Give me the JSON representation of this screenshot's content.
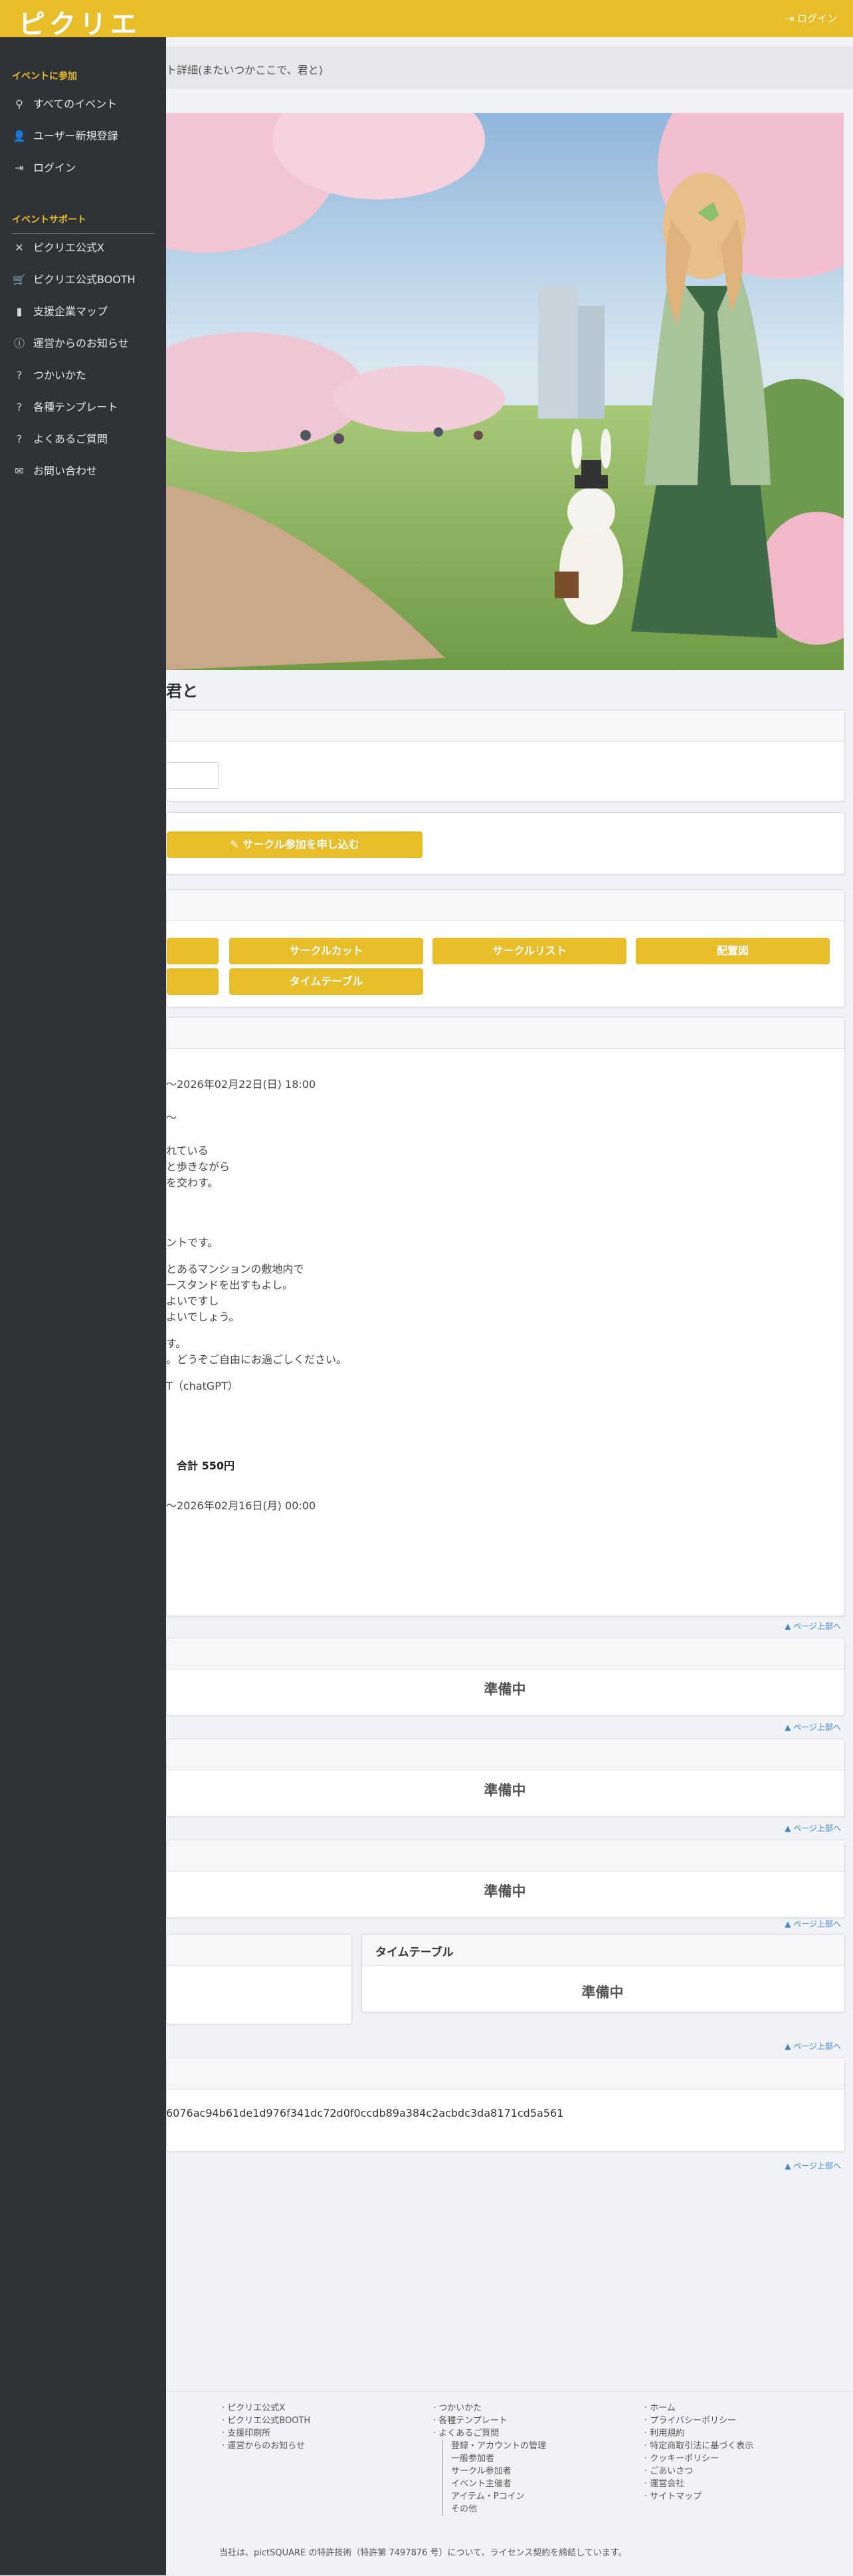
{
  "header": {
    "logo": "ピクリエ",
    "login": "ログイン"
  },
  "breadcrumb": {
    "text": "ト詳細(またいつかここで、君と)"
  },
  "hero": {
    "title": "君と"
  },
  "circle_section": {
    "apply_label": "サークル参加を申し込む"
  },
  "quick_links": {
    "circle_cut": "サークルカット",
    "circle_list": "サークルリスト",
    "layout_map": "配置図",
    "timetable": "タイムテーブル"
  },
  "details": {
    "lines": [
      "〜2026年02月22日(日) 18:00",
      "〜",
      "れている",
      "と歩きながら",
      "を交わす。",
      "ントです。",
      "とあるマンションの敷地内で",
      "ースタンドを出すもよし。",
      "よいですし",
      "よいでしょう。",
      "す。",
      "。どうぞご自由にお過ごしください。",
      "T（chatGPT）"
    ],
    "total": "合計 550円",
    "deadline": "〜2026年02月16日(月) 00:00"
  },
  "pending": {
    "label": "準備中"
  },
  "timetable_card": {
    "title": "タイムテーブル"
  },
  "hash": {
    "value": "6076ac94b61de1d976f341dc72d0f0ccdb89a384c2acbdc3da8171cd5a561"
  },
  "page_top": "ページ上部へ",
  "sidebar": {
    "join_title": "イベントに参加",
    "join_items": [
      {
        "label": "すべてのイベント",
        "icon": "search-icon"
      },
      {
        "label": "ユーザー新規登録",
        "icon": "user-plus-icon"
      },
      {
        "label": "ログイン",
        "icon": "login-icon"
      }
    ],
    "support_title": "イベントサポート",
    "support_items": [
      {
        "label": "ピクリエ公式X",
        "icon": "x-icon"
      },
      {
        "label": "ピクリエ公式BOOTH",
        "icon": "cart-icon"
      },
      {
        "label": "支援企業マップ",
        "icon": "building-icon"
      },
      {
        "label": "運営からのお知らせ",
        "icon": "info-icon"
      },
      {
        "label": "つかいかた",
        "icon": "question-icon"
      },
      {
        "label": "各種テンプレート",
        "icon": "question-icon"
      },
      {
        "label": "よくあるご質問",
        "icon": "question-icon"
      },
      {
        "label": "お問い合わせ",
        "icon": "mail-icon"
      }
    ]
  },
  "footer": {
    "col1": [
      "ピクリエ公式X",
      "ピクリエ公式BOOTH",
      "支援印刷所",
      "運営からのお知らせ"
    ],
    "col2": [
      "つかいかた",
      "各種テンプレート",
      "よくあるご質問"
    ],
    "col2_sub": [
      "登録・アカウントの管理",
      "一般参加者",
      "サークル参加者",
      "イベント主催者",
      "アイテム・Pコイン",
      "その他"
    ],
    "col3": [
      "ホーム",
      "プライバシーポリシー",
      "利用規約",
      "特定商取引法に基づく表示",
      "クッキーポリシー",
      "ごあいさつ",
      "運営会社",
      "サイトマップ"
    ],
    "copyright": "当社は、pictSQUARE の特許技術（特許第 7497876 号）について、ライセンス契約を締結しています。"
  },
  "colors": {
    "accent": "#e8bd2a",
    "sidebar": "#2f3338"
  }
}
